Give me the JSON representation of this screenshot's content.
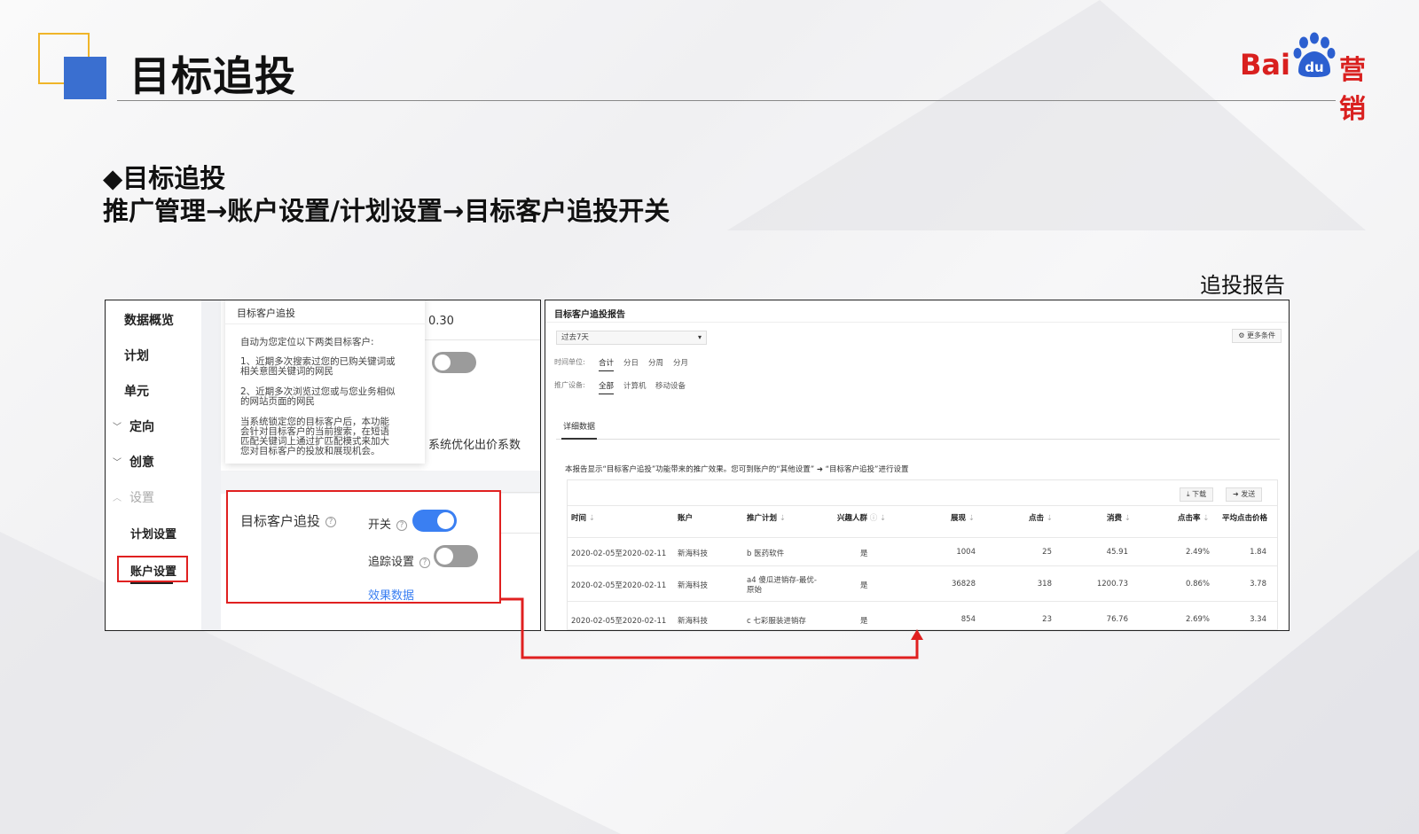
{
  "header": {
    "title": "目标追投",
    "logo_text_left": "Bai",
    "logo_text_du": "du",
    "logo_text_right": "营销"
  },
  "subtitle": {
    "line1": "◆目标追投",
    "line2": "推广管理→账户设置/计划设置→目标客户追投开关"
  },
  "report_label": "追投报告",
  "left_panel": {
    "nav": {
      "overview": "数据概览",
      "plan": "计划",
      "unit": "单元",
      "targeting": "定向",
      "creative": "创意",
      "settings": "设置",
      "plan_settings": "计划设置",
      "account_settings": "账户设置"
    },
    "value_030": "0.30",
    "sys_coef": "系统优化出价系数",
    "tooltip": {
      "title": "目标客户追投",
      "intro": "自动为您定位以下两类目标客户:",
      "item1_a": "1、近期多次搜索过您的已购关键词或",
      "item1_b": "相关意图关键词的网民",
      "item2_a": "2、近期多次浏览过您或与您业务相似",
      "item2_b": "的网站页面的网民",
      "desc_a": "当系统锁定您的目标客户后，本功能",
      "desc_b": "会针对目标客户的当前搜索，在短语",
      "desc_c": "匹配关键词上通过扩匹配模式来加大",
      "desc_d": "您对目标客户的投放和展现机会。"
    },
    "switch_box": {
      "label": "目标客户追投",
      "switch_label": "开关",
      "tracking_label": "追踪设置",
      "link": "效果数据",
      "help": "?"
    }
  },
  "right_panel": {
    "title": "目标客户追投报告",
    "date_select": "过去7天",
    "more_conditions": "⚙ 更多条件",
    "time_unit_label": "时间单位:",
    "time_units": [
      "合计",
      "分日",
      "分周",
      "分月"
    ],
    "device_label": "推广设备:",
    "devices": [
      "全部",
      "计算机",
      "移动设备"
    ],
    "tab": "详细数据",
    "note": "本报告显示“目标客户追投”功能带来的推广效果。您可到账户的“其他设置” ➜ “目标客户追投”进行设置",
    "download": "⤓ 下载",
    "send": "➜ 发送",
    "columns": [
      "时间",
      "账户",
      "推广计划",
      "兴趣人群",
      "展现",
      "点击",
      "消费",
      "点击率",
      "平均点击价格"
    ],
    "rows": [
      {
        "time": "2020-02-05至2020-02-11",
        "account": "新海科技",
        "plan": "b 医药软件",
        "plan2": "",
        "interest": "是",
        "impressions": "1004",
        "clicks": "25",
        "cost": "45.91",
        "ctr": "2.49%",
        "cpc": "1.84"
      },
      {
        "time": "2020-02-05至2020-02-11",
        "account": "新海科技",
        "plan": "a4 傻瓜进销存-最优-",
        "plan2": "原始",
        "interest": "是",
        "impressions": "36828",
        "clicks": "318",
        "cost": "1200.73",
        "ctr": "0.86%",
        "cpc": "3.78"
      },
      {
        "time": "2020-02-05至2020-02-11",
        "account": "新海科技",
        "plan": "c 七彩服装进销存",
        "plan2": "",
        "interest": "是",
        "impressions": "854",
        "clicks": "23",
        "cost": "76.76",
        "ctr": "2.69%",
        "cpc": "3.34"
      }
    ]
  },
  "colors": {
    "accent_blue": "#3a6fd0",
    "accent_yellow": "#f0b529",
    "highlight_red": "#e02020",
    "toggle_on": "#3a7ff2",
    "baidu_red": "#d9201f"
  }
}
